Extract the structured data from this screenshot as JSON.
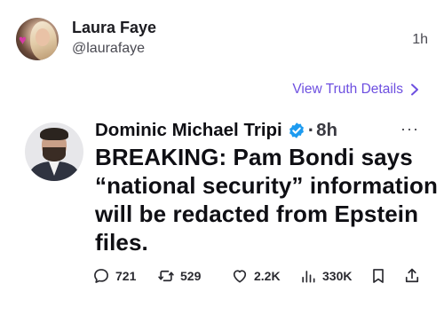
{
  "truth_post": {
    "author_name": "Laura Faye",
    "author_handle": "@laurafaye",
    "time": "1h",
    "view_details_label": "View Truth Details"
  },
  "tweet": {
    "author_name": "Dominic Michael Tripi",
    "separator": "·",
    "age": "8h",
    "more": "···",
    "text": "BREAKING: Pam Bondi says “national security” information will be redacted from Epstein files.",
    "stats": {
      "replies": "721",
      "reposts": "529",
      "likes": "2.2K",
      "views": "330K"
    }
  },
  "icons": {
    "truth_avatar": "avatar-photo",
    "view_details": "chevron-right-icon",
    "verified": "verified-badge-icon",
    "reply": "reply-icon",
    "repost": "repost-icon",
    "like": "heart-icon",
    "views": "views-chart-icon",
    "bookmark": "bookmark-icon",
    "share": "share-icon"
  },
  "colors": {
    "accent_link": "#6d4fe0",
    "verified_blue": "#1d9bf0",
    "text_primary": "#0f0f14",
    "text_secondary": "#4a4a52"
  }
}
